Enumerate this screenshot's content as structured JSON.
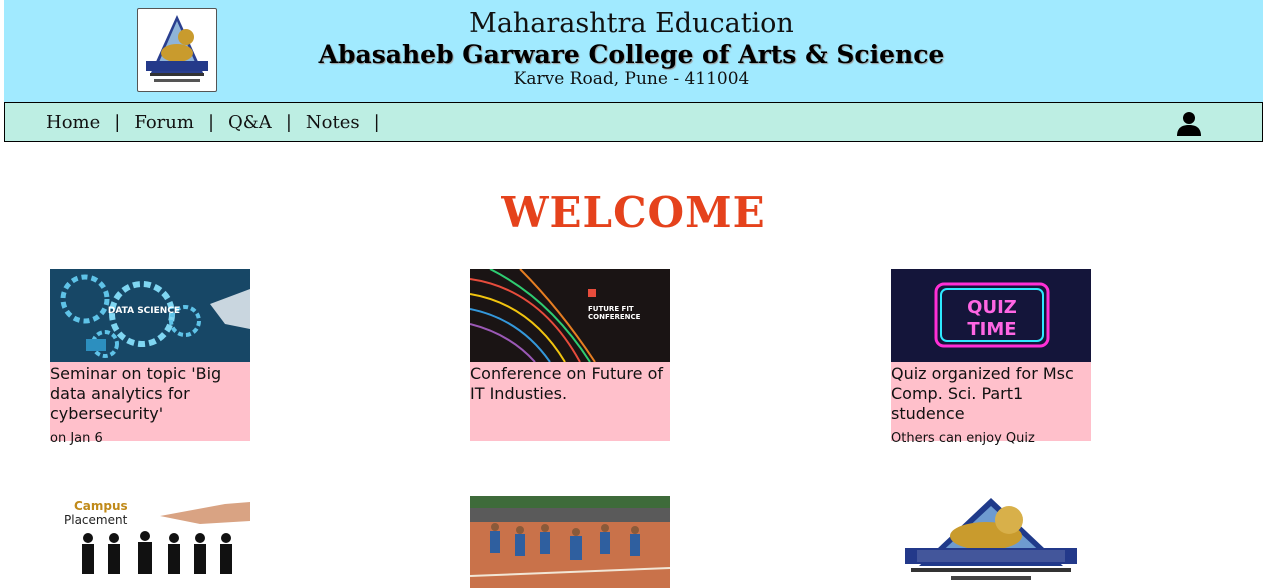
{
  "header": {
    "line1": "Maharashtra Education",
    "line2": "Abasaheb Garware College of Arts & Science",
    "line3": "Karve Road, Pune - 411004"
  },
  "nav": {
    "items": [
      "Home",
      "Forum",
      "Q&A",
      "Notes"
    ],
    "separator": "|"
  },
  "welcome": "WELCOME",
  "cards": [
    {
      "title": "Seminar on topic 'Big data analytics for cybersecurity'",
      "sub": "on Jan 6",
      "image_text": "DATA SCIENCE"
    },
    {
      "title": "Conference on Future of IT Industies.",
      "sub": "",
      "image_text_1": "FUTURE FIT",
      "image_text_2": "CONFERENCE"
    },
    {
      "title": "Quiz organized for Msc Comp. Sci. Part1 studence",
      "sub": "Others can enjoy Quiz",
      "image_text_1": "QUIZ",
      "image_text_2": "TIME"
    }
  ],
  "row2": {
    "placement_text_1": "Campus",
    "placement_text_2": "Placement"
  },
  "colors": {
    "header_bg": "#a1eaff",
    "nav_bg": "#bdeee3",
    "welcome": "#e5421c",
    "card_bg": "#ffc0cb"
  }
}
